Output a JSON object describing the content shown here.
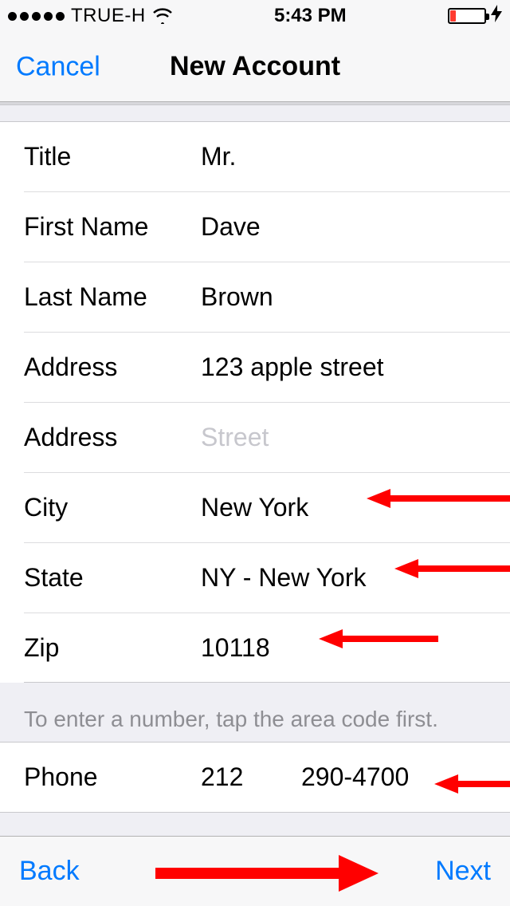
{
  "status": {
    "carrier": "TRUE-H",
    "time": "5:43 PM"
  },
  "nav": {
    "cancel": "Cancel",
    "title": "New Account"
  },
  "form": {
    "title_label": "Title",
    "title_value": "Mr.",
    "first_name_label": "First Name",
    "first_name_value": "Dave",
    "last_name_label": "Last Name",
    "last_name_value": "Brown",
    "address1_label": "Address",
    "address1_value": "123 apple street",
    "address2_label": "Address",
    "address2_placeholder": "Street",
    "city_label": "City",
    "city_value": "New York",
    "state_label": "State",
    "state_value": "NY - New York",
    "zip_label": "Zip",
    "zip_value": "10118"
  },
  "phone": {
    "note": "To enter a number, tap the area code first.",
    "label": "Phone",
    "area": "212",
    "number": "290-4700"
  },
  "toolbar": {
    "back": "Back",
    "next": "Next"
  }
}
